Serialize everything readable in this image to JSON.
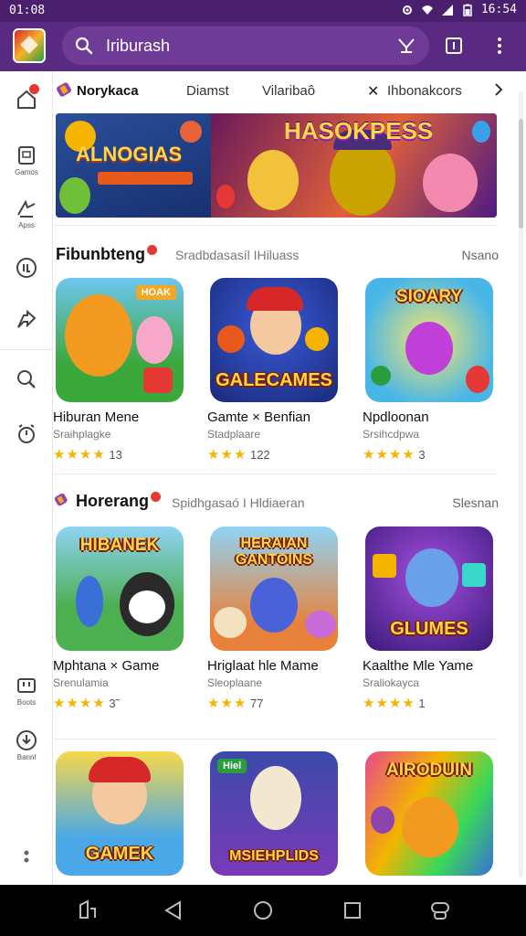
{
  "status_bar": {
    "time": "01:08",
    "right_time": "16:54"
  },
  "search": {
    "query": "Iriburash"
  },
  "categories": [
    {
      "label": "Norykaca",
      "active": true
    },
    {
      "label": "Diamst"
    },
    {
      "label": "Vilaribaô"
    },
    {
      "label": "Ihbonakcors"
    }
  ],
  "banner": {
    "left_title": "ALNOGIAS",
    "right_title": "HASOKPESS"
  },
  "sections": [
    {
      "title": "Fibunbteng",
      "subtitle": "Sradbdasasíl IHiluass",
      "more": "Nsano",
      "apps": [
        {
          "name": "Hiburan Mene",
          "dev": "Sraihplagke",
          "rating": "13",
          "stars": "★★★★",
          "art_top": "",
          "art_bottom": "",
          "tag": "HOAK"
        },
        {
          "name": "Gamte × Benfian",
          "dev": "Stadplaare",
          "rating": "122",
          "stars": "★★★",
          "art_top": "",
          "art_bottom": "GALECAMES",
          "tag": ""
        },
        {
          "name": "Npdloonan",
          "dev": "Srsihcdpwa",
          "rating": "3",
          "stars": "★★★★",
          "art_top": "SIOARY",
          "art_bottom": "",
          "tag": ""
        }
      ]
    },
    {
      "title": "Horerang",
      "subtitle": "Spidhgasaó I Hldiaeran",
      "more": "Slesnan",
      "apps": [
        {
          "name": "Mphtana × Game",
          "dev": "Srenulamia",
          "rating": "3̃",
          "stars": "★★★★",
          "art_top": "HIBANEK",
          "art_bottom": "",
          "tag": ""
        },
        {
          "name": "Hriglaat hle Mame",
          "dev": "Sleoplaane",
          "rating": "77",
          "stars": "★★★",
          "art_top": "HERAIAN GANTOINS",
          "art_bottom": "",
          "tag": ""
        },
        {
          "name": "Kaalthe Mle Yame",
          "dev": "Sraliokayca",
          "rating": "1",
          "stars": "★★★★",
          "art_top": "",
          "art_bottom": "GLUMES",
          "tag": ""
        }
      ]
    },
    {
      "apps": [
        {
          "art_top": "",
          "art_bottom": "GAMEK"
        },
        {
          "art_top": "",
          "art_bottom": "MSIEHPLIDS",
          "tag": "Hiel"
        },
        {
          "art_top": "AIRODUIN",
          "art_bottom": ""
        }
      ]
    }
  ],
  "sidebar": {
    "items": [
      {
        "icon": "home-icon",
        "label": ""
      },
      {
        "icon": "games-icon",
        "label": "Gamos"
      },
      {
        "icon": "apps-icon",
        "label": "Apss"
      },
      {
        "icon": "movies-icon",
        "label": ""
      },
      {
        "icon": "share-icon",
        "label": ""
      },
      {
        "icon": "search-icon",
        "label": ""
      },
      {
        "icon": "alarm-icon",
        "label": ""
      },
      {
        "icon": "library-icon",
        "label": "Boots"
      },
      {
        "icon": "download-icon",
        "label": "Bannl"
      },
      {
        "icon": "more-icon",
        "label": ""
      }
    ]
  },
  "colors": {
    "header": "#5a2a82",
    "status": "#4a1f6e",
    "stars": "#f4b400",
    "badge": "#e53935"
  }
}
